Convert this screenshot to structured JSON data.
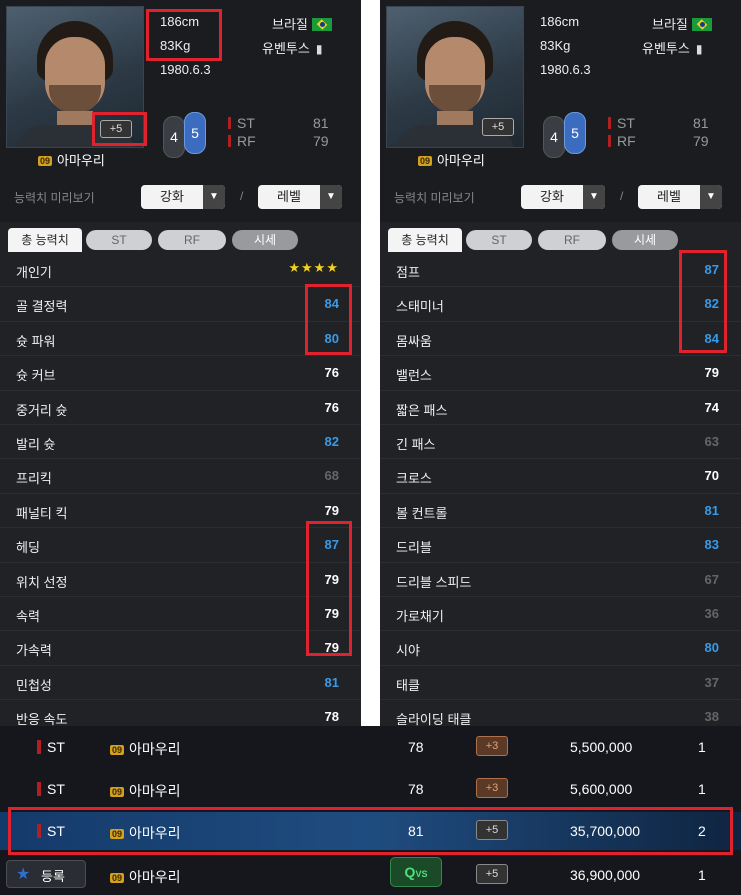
{
  "player": {
    "name": "아마우리",
    "season_badge": "09",
    "height": "186cm",
    "weight": "83Kg",
    "birth": "1980.6.3",
    "nation": "브라질",
    "club": "유벤투스",
    "enhance_badge": "+5",
    "weak_foot": "4",
    "strong_foot": "5",
    "positions": [
      {
        "pos": "ST",
        "rating": "81"
      },
      {
        "pos": "RF",
        "rating": "79"
      }
    ]
  },
  "preview": {
    "label": "능력치 미리보기",
    "enhance_dropdown": "강화",
    "level_dropdown": "레벨",
    "separator": "/"
  },
  "tabs": [
    "총 능력치",
    "ST",
    "RF",
    "시세"
  ],
  "stats_left": [
    {
      "label": "개인기",
      "value": "★★★★",
      "tone": "stars"
    },
    {
      "label": "골 결정력",
      "value": "84",
      "tone": "blue"
    },
    {
      "label": "슛 파워",
      "value": "80",
      "tone": "blue"
    },
    {
      "label": "슛 커브",
      "value": "76",
      "tone": "white"
    },
    {
      "label": "중거리 슛",
      "value": "76",
      "tone": "white"
    },
    {
      "label": "발리 슛",
      "value": "82",
      "tone": "blue"
    },
    {
      "label": "프리킥",
      "value": "68",
      "tone": "gray"
    },
    {
      "label": "패널티 킥",
      "value": "79",
      "tone": "white"
    },
    {
      "label": "헤딩",
      "value": "87",
      "tone": "blue"
    },
    {
      "label": "위치 선정",
      "value": "79",
      "tone": "white"
    },
    {
      "label": "속력",
      "value": "79",
      "tone": "white"
    },
    {
      "label": "가속력",
      "value": "79",
      "tone": "white"
    },
    {
      "label": "민첩성",
      "value": "81",
      "tone": "blue"
    },
    {
      "label": "반응 속도",
      "value": "78",
      "tone": "white"
    }
  ],
  "stats_right": [
    {
      "label": "점프",
      "value": "87",
      "tone": "blue"
    },
    {
      "label": "스태미너",
      "value": "82",
      "tone": "blue"
    },
    {
      "label": "몸싸움",
      "value": "84",
      "tone": "blue"
    },
    {
      "label": "밸런스",
      "value": "79",
      "tone": "white"
    },
    {
      "label": "짧은 패스",
      "value": "74",
      "tone": "white"
    },
    {
      "label": "긴 패스",
      "value": "63",
      "tone": "gray"
    },
    {
      "label": "크로스",
      "value": "70",
      "tone": "white"
    },
    {
      "label": "볼 컨트롤",
      "value": "81",
      "tone": "blue"
    },
    {
      "label": "드리블",
      "value": "83",
      "tone": "blue"
    },
    {
      "label": "드리블 스피드",
      "value": "67",
      "tone": "gray"
    },
    {
      "label": "가로채기",
      "value": "36",
      "tone": "gray"
    },
    {
      "label": "시야",
      "value": "80",
      "tone": "blue"
    },
    {
      "label": "태클",
      "value": "37",
      "tone": "gray"
    },
    {
      "label": "슬라이딩 태클",
      "value": "38",
      "tone": "gray"
    }
  ],
  "market": [
    {
      "pos": "ST",
      "badge": "09",
      "name": "아마우리",
      "ovr": "78",
      "enhance": "+3",
      "price": "5,500,000",
      "count": "1"
    },
    {
      "pos": "ST",
      "badge": "09",
      "name": "아마우리",
      "ovr": "78",
      "enhance": "+3",
      "price": "5,600,000",
      "count": "1"
    },
    {
      "pos": "ST",
      "badge": "09",
      "name": "아마우리",
      "ovr": "81",
      "enhance": "+5",
      "price": "35,700,000",
      "count": "2"
    },
    {
      "pos": "",
      "badge": "09",
      "name": "아마우리",
      "ovr": "",
      "enhance": "+5",
      "price": "36,900,000",
      "count": "1"
    }
  ],
  "register_button": "등록",
  "vs_button": "VS",
  "colors": {
    "highlight": "#e0222e",
    "stat_blue": "#3a9ae6",
    "panel_bg": "#202226"
  }
}
